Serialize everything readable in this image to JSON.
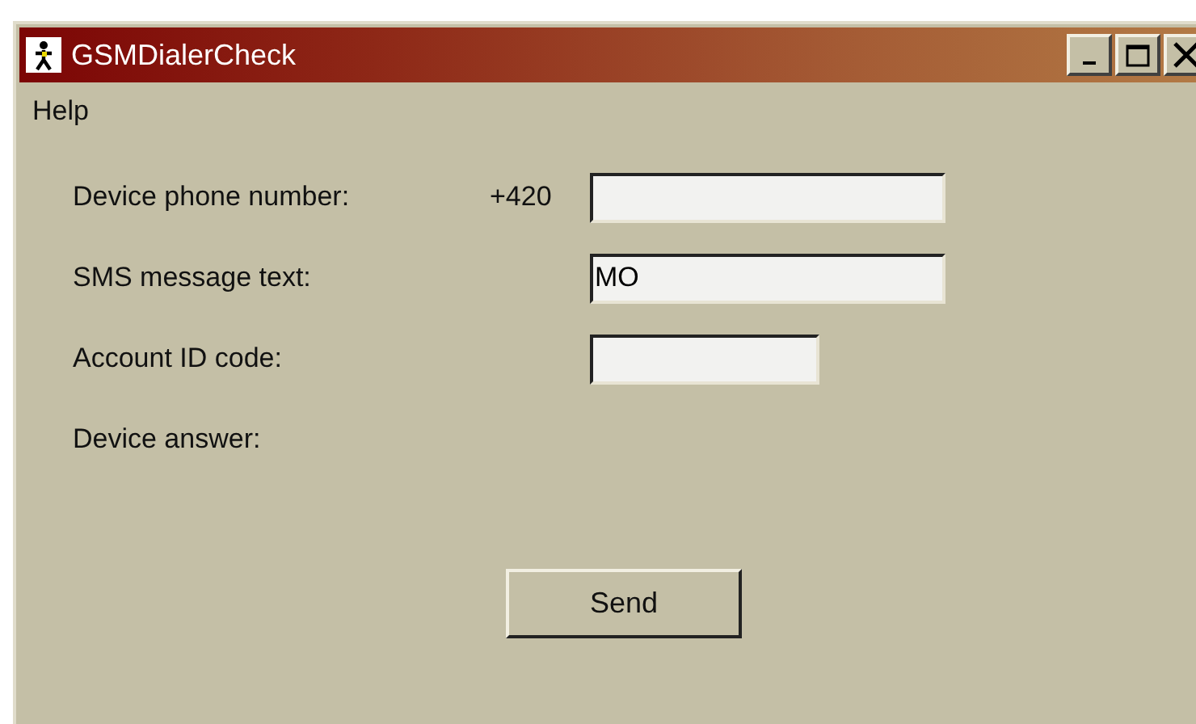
{
  "window": {
    "title": "GSMDialerCheck"
  },
  "menu": [
    "Help"
  ],
  "form": [
    {
      "kind": "phone",
      "label": "Device phone number:",
      "prefix": "+420"
    },
    {
      "kind": "text",
      "label": "SMS message text:",
      "value": "MO"
    },
    {
      "kind": "short",
      "label": "Account ID code:"
    },
    {
      "kind": "output",
      "label": "Device answer:"
    }
  ],
  "buttons": [
    "Send"
  ]
}
